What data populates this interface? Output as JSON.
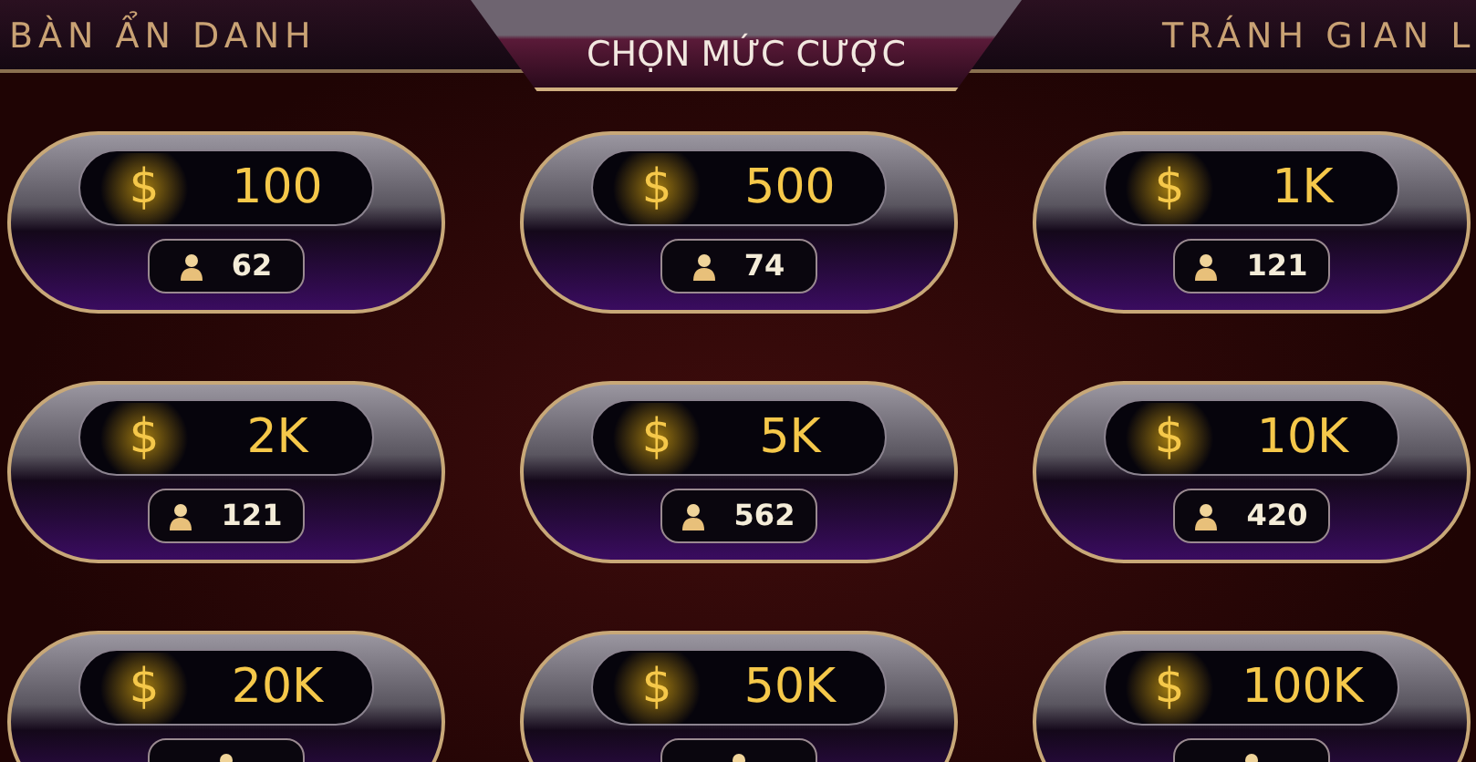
{
  "tabs": [
    {
      "label": "BÀN ẨN DANH",
      "selected": false
    },
    {
      "label": "CHỌN MỨC CƯỢC",
      "selected": true
    },
    {
      "label": "TRÁNH GIAN L",
      "selected": false
    }
  ],
  "bets": [
    {
      "currency": "$",
      "amount": "100",
      "players": "62"
    },
    {
      "currency": "$",
      "amount": "500",
      "players": "74"
    },
    {
      "currency": "$",
      "amount": "1K",
      "players": "121"
    },
    {
      "currency": "$",
      "amount": "2K",
      "players": "121"
    },
    {
      "currency": "$",
      "amount": "5K",
      "players": "562"
    },
    {
      "currency": "$",
      "amount": "10K",
      "players": "420"
    },
    {
      "currency": "$",
      "amount": "20K"
    },
    {
      "currency": "$",
      "amount": "50K"
    },
    {
      "currency": "$",
      "amount": "100K"
    }
  ]
}
